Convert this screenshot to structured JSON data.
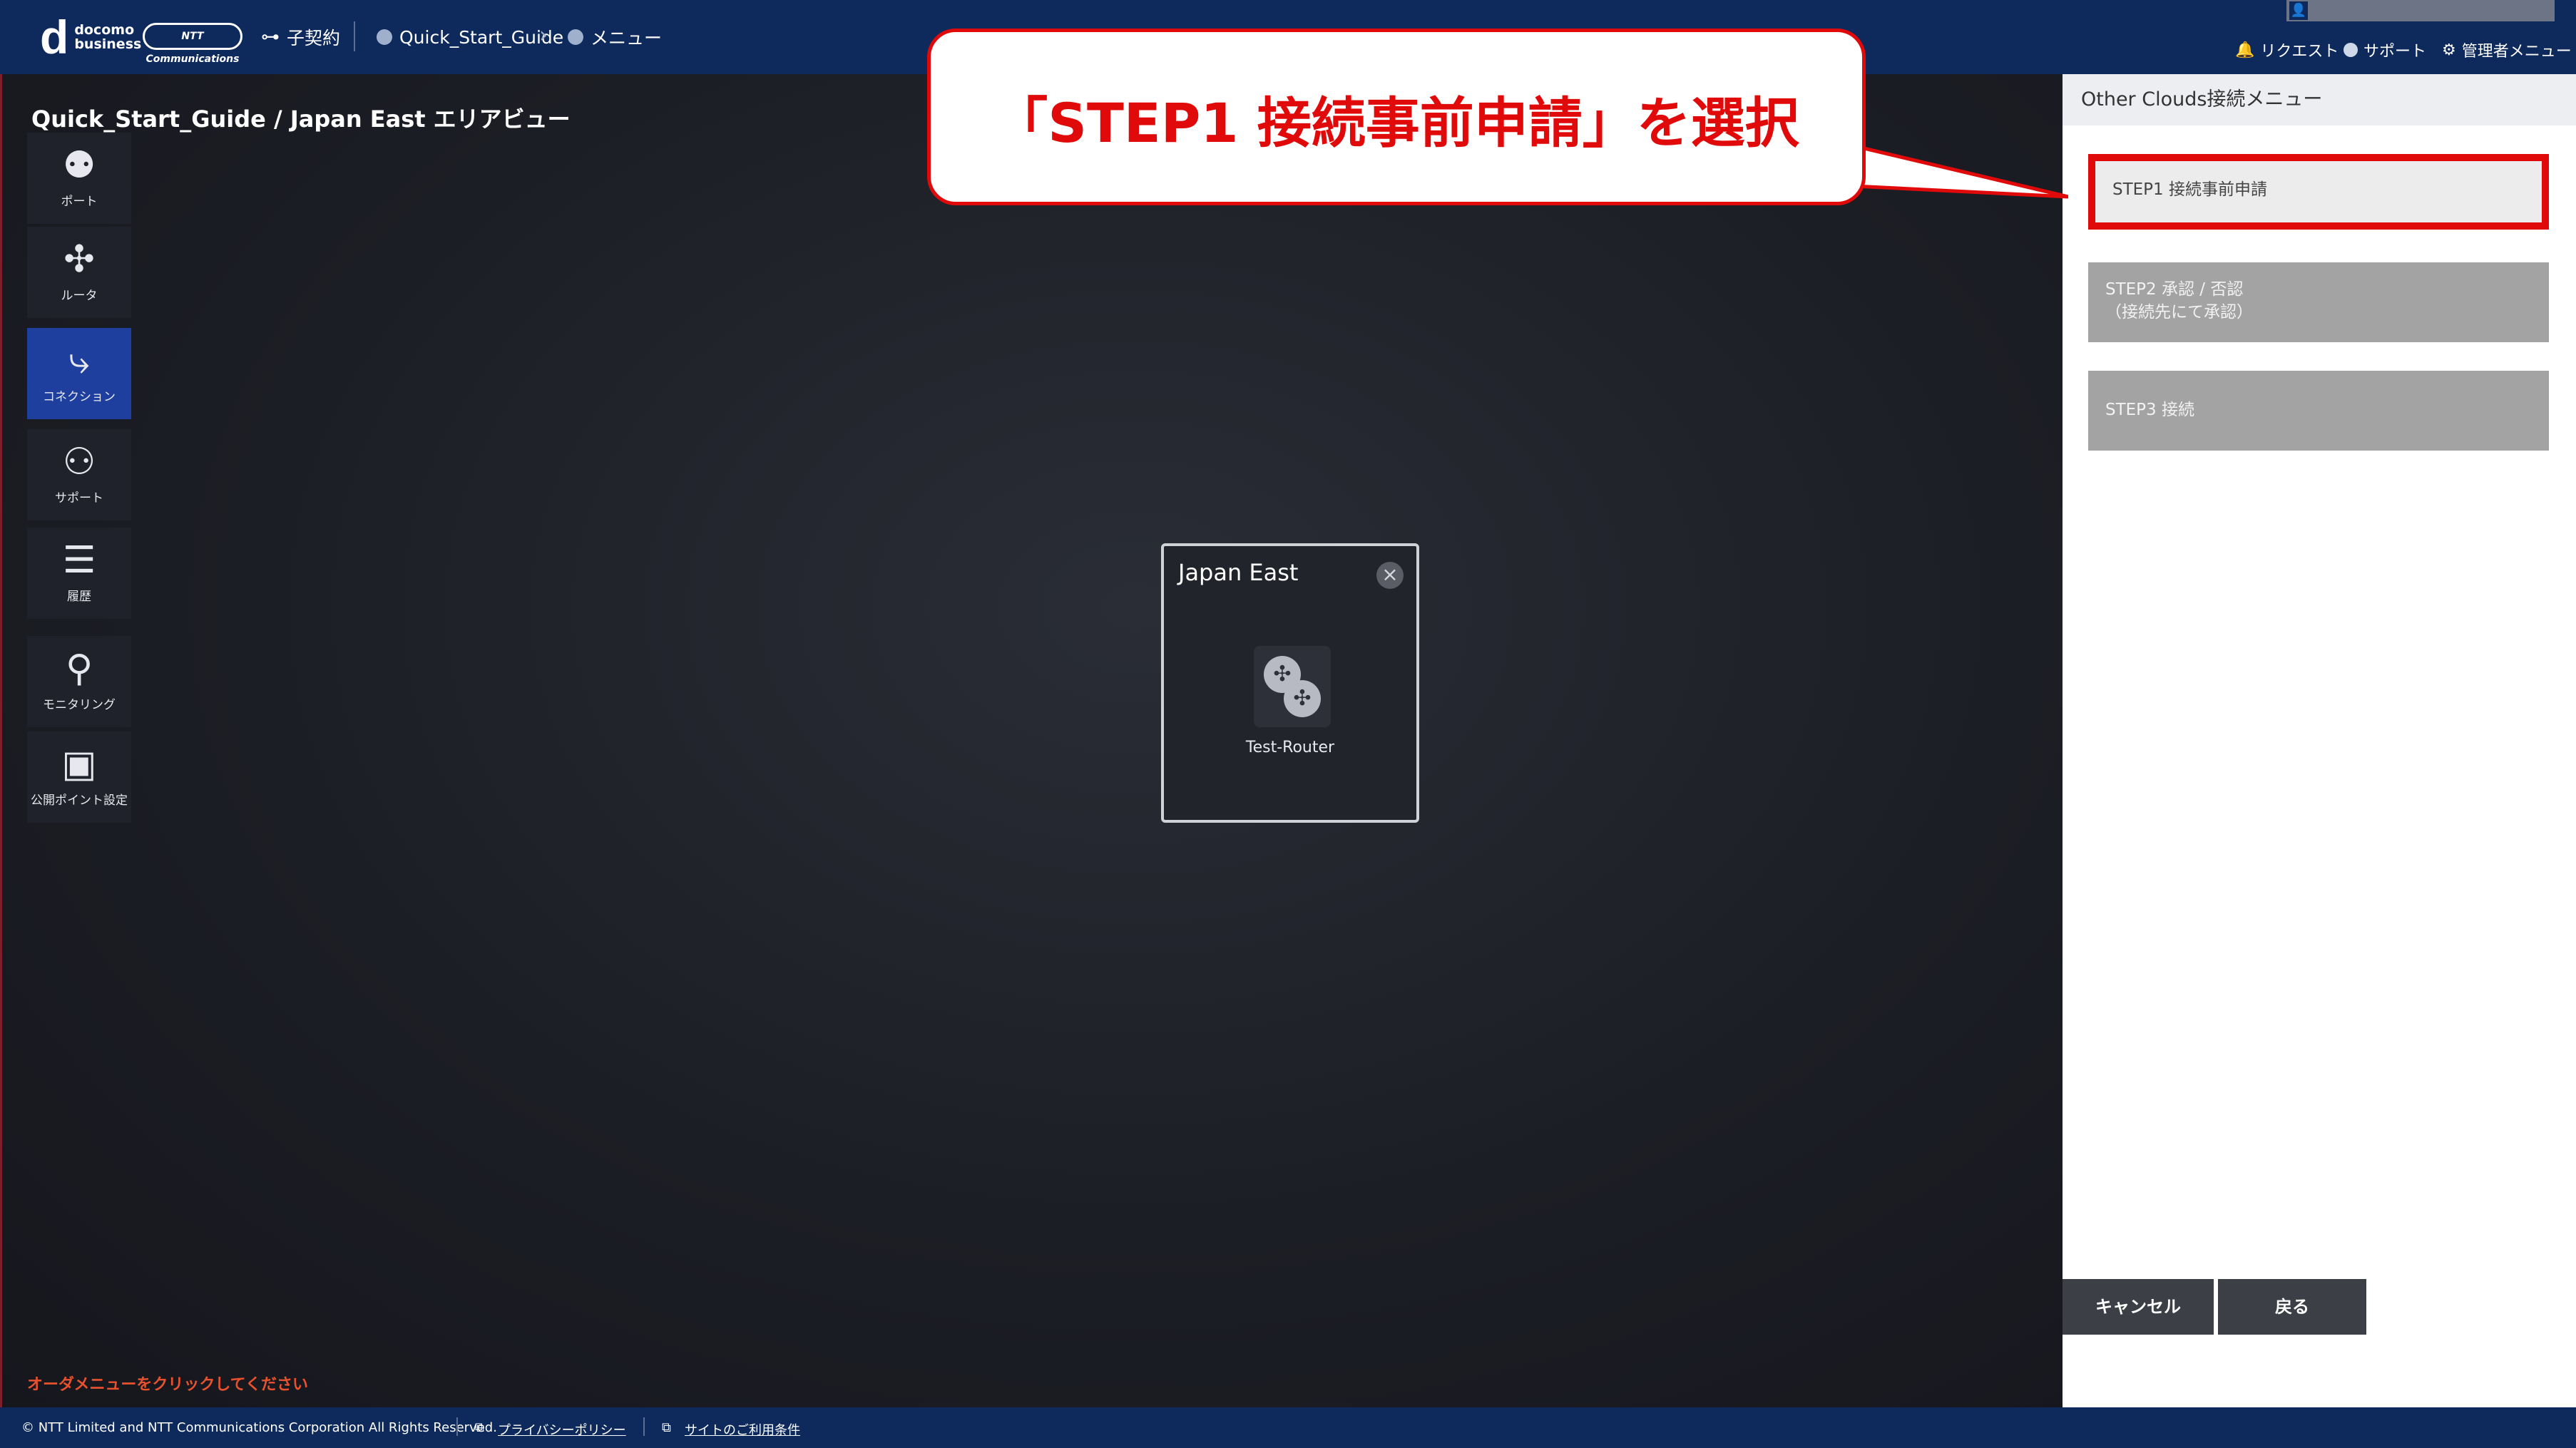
{
  "topbar": {
    "brand_mark": "d",
    "brand_line1": "docomo",
    "brand_line2": "business",
    "ntt_logo": "NTT Communications",
    "subcontract": "子契約",
    "breadcrumb_project": "Quick_Start_Guide",
    "breadcrumb_menu": "メニュー",
    "request": "リクエスト",
    "support": "サポート",
    "admin_menu": "管理者メニュー"
  },
  "view": {
    "title": "Quick_Start_Guide / Japan East エリアビュー",
    "order_hint": "オーダメニューをクリックしてください"
  },
  "sidebar": {
    "items": [
      {
        "label": "ポート",
        "icon": "port-icon"
      },
      {
        "label": "ルータ",
        "icon": "router-icon"
      },
      {
        "label": "コネクション",
        "icon": "connection-icon",
        "active": true
      },
      {
        "label": "サポート",
        "icon": "support-icon"
      },
      {
        "label": "履歴",
        "icon": "history-icon"
      },
      {
        "label": "モニタリング",
        "icon": "monitoring-icon"
      },
      {
        "label": "公開ポイント設定",
        "icon": "public-point-icon"
      }
    ]
  },
  "area_card": {
    "title": "Japan East",
    "router_name": "Test-Router"
  },
  "panel": {
    "header": "Other Clouds接続メニュー",
    "step1": "STEP1 接続事前申請",
    "step2_line1": "STEP2 承認 / 否認",
    "step2_line2": "（接続先にて承認）",
    "step3": "STEP3 接続",
    "cancel": "キャンセル",
    "back": "戻る"
  },
  "footer": {
    "copyright": "© NTT Limited and NTT Communications Corporation All Rights Reserved.",
    "privacy": "プライバシーポリシー",
    "terms": "サイトのご利用条件"
  },
  "callout": {
    "text": "「STEP1 接続事前申請」を選択"
  },
  "colors": {
    "header_bg": "#0e2a5c",
    "highlight_red": "#e10a0a",
    "active_tab": "#1f3f9e",
    "disabled_step": "#a3a3a3"
  }
}
